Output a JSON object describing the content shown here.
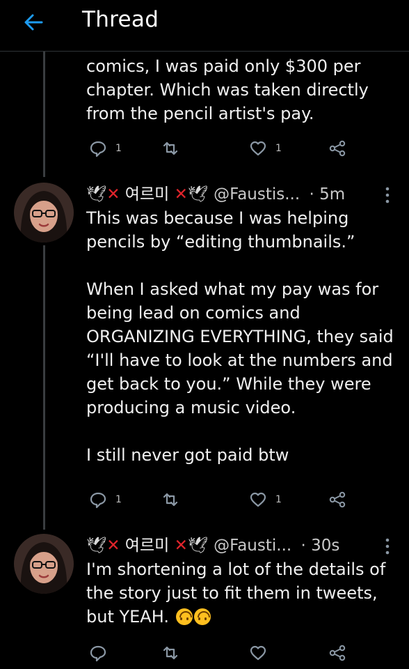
{
  "header": {
    "title": "Thread"
  },
  "tweets": [
    {
      "text": "comics, I was paid only $300 per\nchapter. Which was taken directly\nfrom the pencil artist's pay.",
      "reply_count": "1",
      "like_count": "1"
    },
    {
      "author": {
        "dove": "🕊",
        "cross": "✕",
        "name": "여르미"
      },
      "handle": "@Faustis...",
      "time": "· 5m",
      "text": "This was because I was helping\npencils by “editing thumbnails.”\n\nWhen I asked what my pay was for\nbeing lead on comics and\nORGANIZING EVERYTHING, they said\n“I'll have to look at the numbers and\nget back to you.” While they were\nproducing a music video.\n\nI still never got paid btw",
      "reply_count": "1",
      "like_count": "1"
    },
    {
      "author": {
        "dove": "🕊",
        "cross": "✕",
        "name": "여르미"
      },
      "handle": "@Fausti...",
      "time": "· 30s",
      "text": "I'm shortening a lot of the details of\nthe story just to fit them in tweets,\nbut YEAH.",
      "emojis": [
        "upside-down-face-emoji",
        "upside-down-face-emoji"
      ]
    }
  ],
  "colors": {
    "accent": "#1d9bf0",
    "cross": "#e0242b",
    "icon": "#8b98a5"
  }
}
